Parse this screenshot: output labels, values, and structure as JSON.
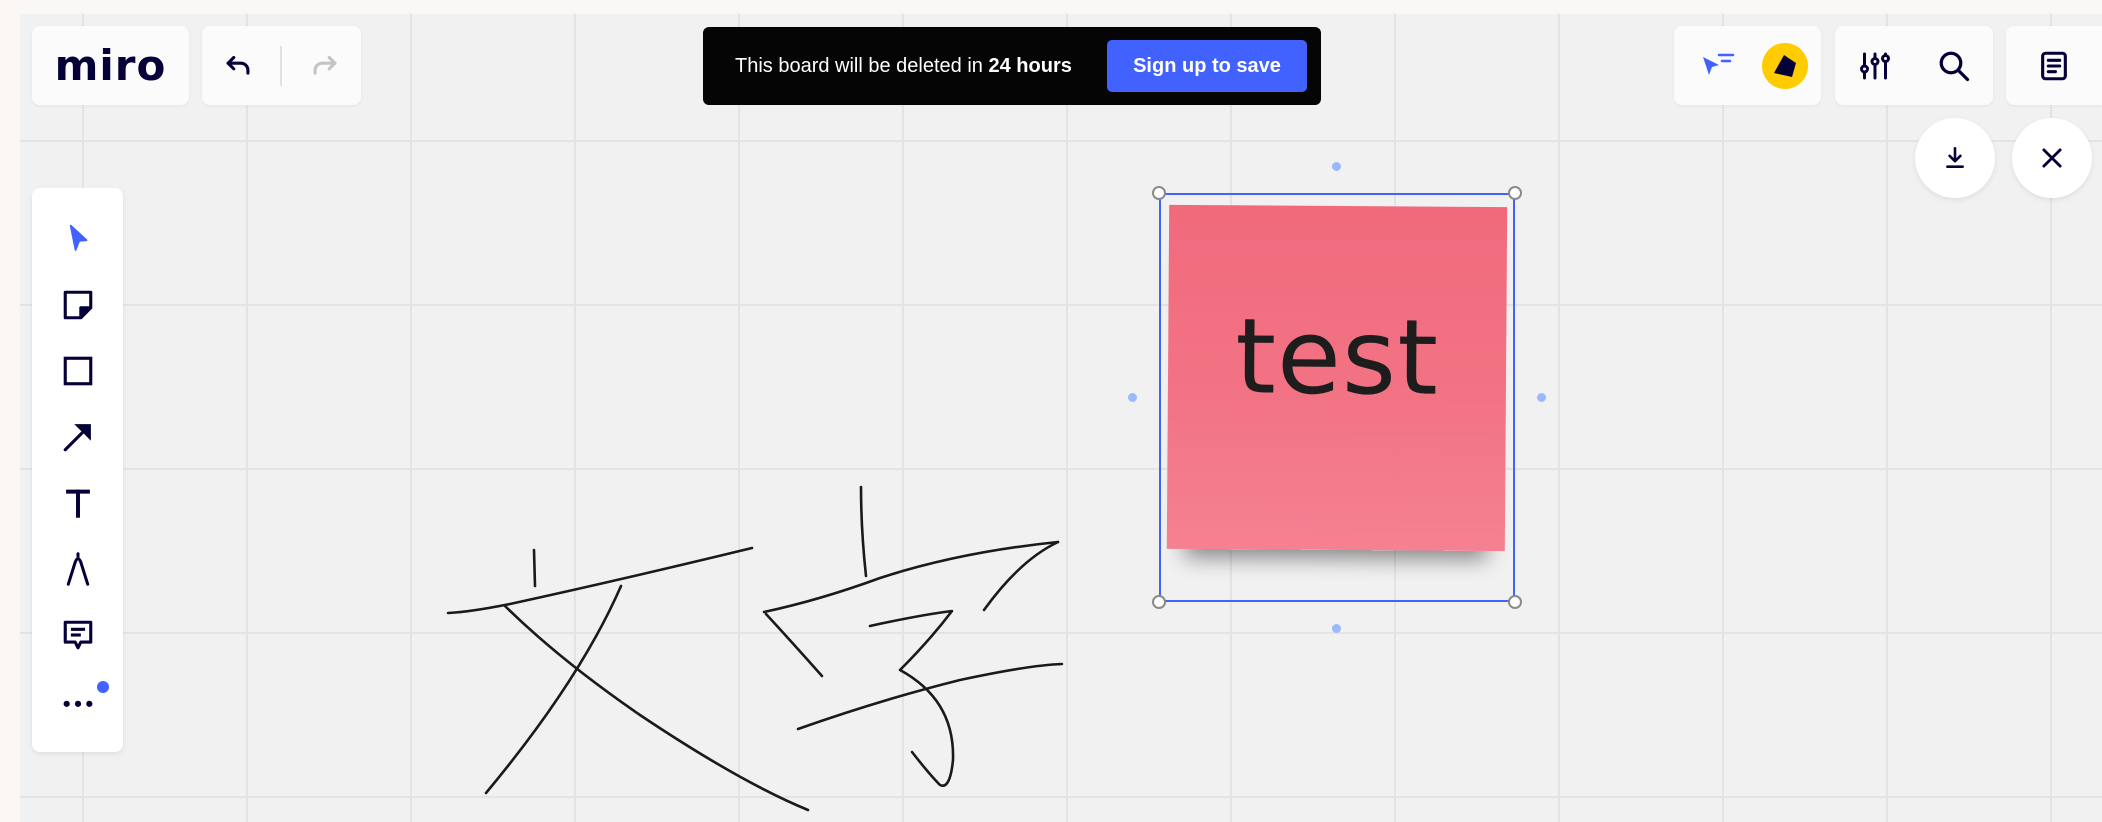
{
  "app": {
    "logo": "miro"
  },
  "banner": {
    "message_prefix": "This board will be deleted in ",
    "message_emphasis": "24 hours",
    "signup_label": "Sign up to save"
  },
  "toolbar": {
    "tools": [
      "select-icon",
      "sticky-note-icon",
      "shape-icon",
      "arrow-line-icon",
      "text-icon",
      "pen-icon",
      "comment-icon",
      "more-icon"
    ],
    "active_tool": "select-icon"
  },
  "canvas": {
    "sticky_note": {
      "text": "test",
      "color": "#f27384"
    }
  },
  "colors": {
    "accent": "#4262ff",
    "banner_bg": "#050505",
    "avatar": "#ffcc00",
    "ink": "#1a1a1a"
  }
}
